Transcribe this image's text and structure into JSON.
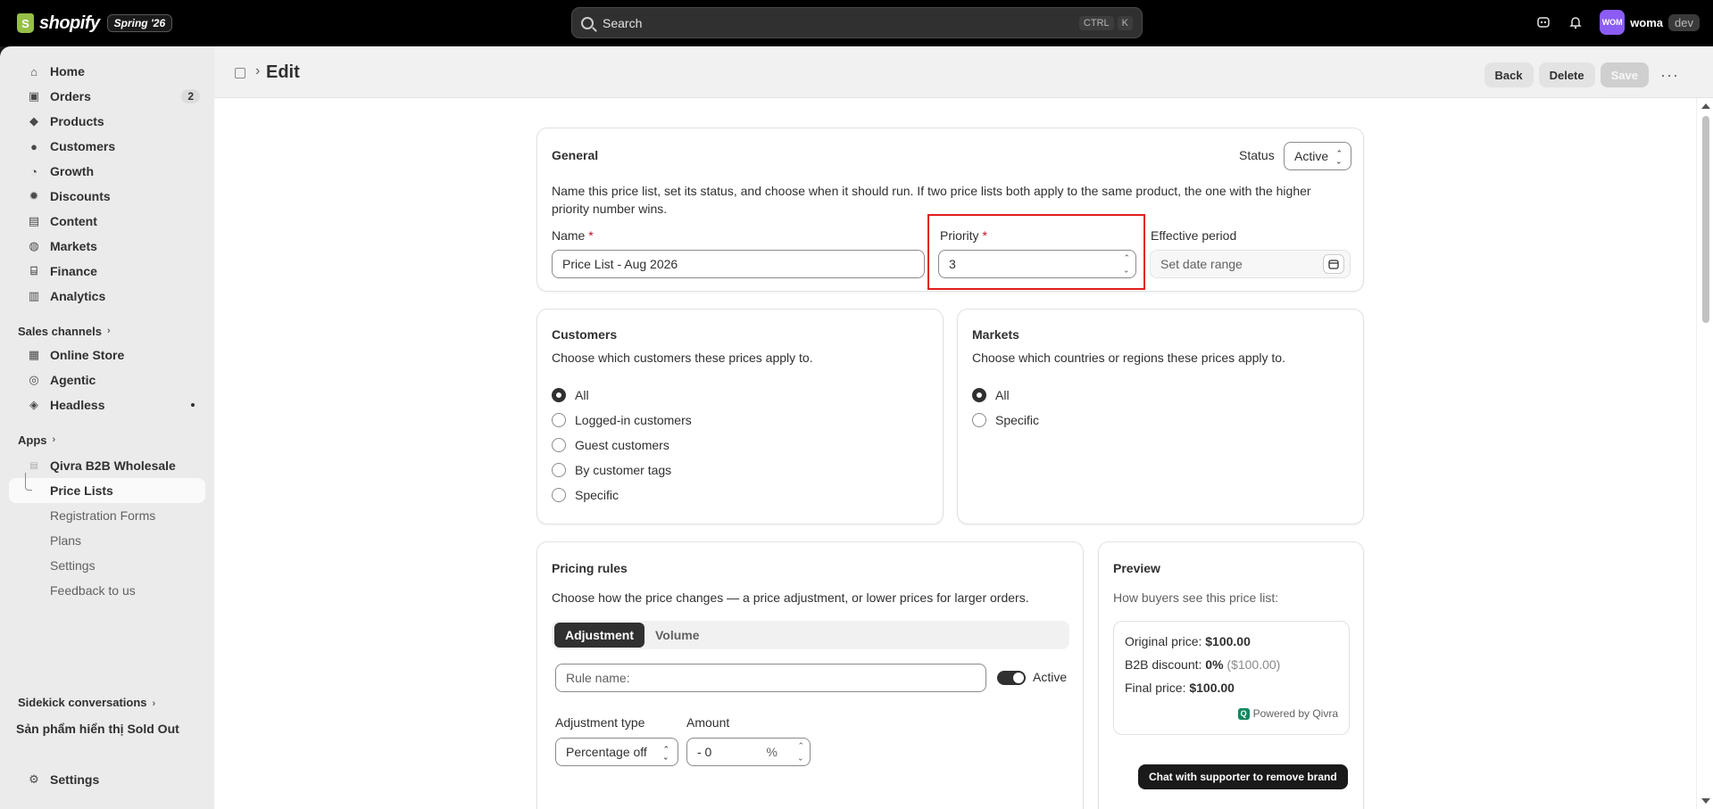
{
  "topbar": {
    "logo_text": "shopify",
    "edition": "Spring '26",
    "search_placeholder": "Search",
    "shortcut_ctrl": "CTRL",
    "shortcut_key": "K",
    "avatar_initials": "WOM",
    "store_name": "woma",
    "env_badge": "dev"
  },
  "sidebar": {
    "items": [
      {
        "label": "Home",
        "icon": "home-icon",
        "glyph": "⌂"
      },
      {
        "label": "Orders",
        "icon": "inbox-icon",
        "glyph": "▣",
        "count": "2"
      },
      {
        "label": "Products",
        "icon": "tag-icon",
        "glyph": "◆"
      },
      {
        "label": "Customers",
        "icon": "person-icon",
        "glyph": "●"
      },
      {
        "label": "Growth",
        "icon": "gauge-icon",
        "glyph": "◔"
      },
      {
        "label": "Discounts",
        "icon": "discount-icon",
        "glyph": "✹"
      },
      {
        "label": "Content",
        "icon": "content-icon",
        "glyph": "▤"
      },
      {
        "label": "Markets",
        "icon": "globe-icon",
        "glyph": "◍"
      },
      {
        "label": "Finance",
        "icon": "bank-icon",
        "glyph": "⌸"
      },
      {
        "label": "Analytics",
        "icon": "bar-chart-icon",
        "glyph": "▥"
      }
    ],
    "sales_channels_label": "Sales channels",
    "channels": [
      {
        "label": "Online Store",
        "icon": "store-icon",
        "glyph": "▦"
      },
      {
        "label": "Agentic",
        "icon": "agentic-icon",
        "glyph": "◎"
      },
      {
        "label": "Headless",
        "icon": "headless-icon",
        "glyph": "◈"
      }
    ],
    "apps_label": "Apps",
    "app_name": "Qivra B2B Wholesale",
    "app_subitems": [
      "Price Lists",
      "Registration Forms",
      "Plans",
      "Settings",
      "Feedback to us"
    ],
    "sidekick_label": "Sidekick conversations",
    "conversation": "Sản phẩm hiển thị Sold Out",
    "settings_label": "Settings"
  },
  "header": {
    "title": "Edit",
    "back_label": "Back",
    "delete_label": "Delete",
    "save_label": "Save"
  },
  "general": {
    "title": "General",
    "status_label": "Status",
    "status_value": "Active",
    "description": "Name this price list, set its status, and choose when it should run. If two price lists both apply to the same product, the one with the higher priority number wins.",
    "name_label": "Name",
    "name_value": "Price List - Aug 2026",
    "priority_label": "Priority",
    "priority_value": "3",
    "effective_label": "Effective period",
    "effective_placeholder": "Set date range",
    "required_mark": "*"
  },
  "customers": {
    "title": "Customers",
    "description": "Choose which customers these prices apply to.",
    "options": [
      "All",
      "Logged-in customers",
      "Guest customers",
      "By customer tags",
      "Specific"
    ],
    "selected": 0
  },
  "markets": {
    "title": "Markets",
    "description": "Choose which countries or regions these prices apply to.",
    "options": [
      "All",
      "Specific"
    ],
    "selected": 0
  },
  "pricing": {
    "title": "Pricing rules",
    "description": "Choose how the price changes — a price adjustment, or lower prices for larger orders.",
    "tabs": [
      "Adjustment",
      "Volume"
    ],
    "rule_placeholder": "Rule name:",
    "active_label": "Active",
    "adjustment_type_label": "Adjustment type",
    "adjustment_type_value": "Percentage off",
    "amount_label": "Amount",
    "amount_value": "- 0",
    "amount_unit": "%"
  },
  "preview": {
    "title": "Preview",
    "description": "How buyers see this price list:",
    "original_label": "Original price:",
    "original_value": "$100.00",
    "discount_label": "B2B discount:",
    "discount_value": "0%",
    "discount_amount": "($100.00)",
    "final_label": "Final price:",
    "final_value": "$100.00",
    "powered_by": "Powered by Qivra",
    "chat_button": "Chat with supporter to remove brand"
  }
}
